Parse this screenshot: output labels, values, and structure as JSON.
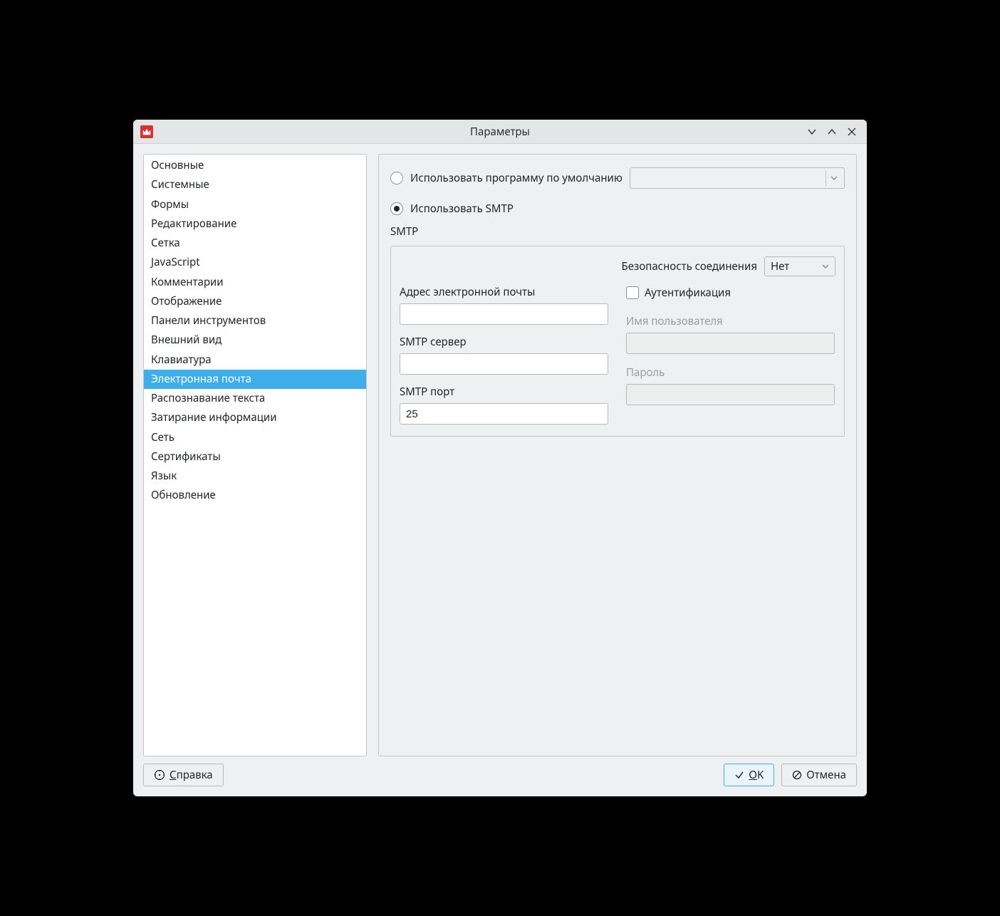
{
  "window": {
    "title": "Параметры"
  },
  "sidebar": {
    "items": [
      "Основные",
      "Системные",
      "Формы",
      "Редактирование",
      "Сетка",
      "JavaScript",
      "Комментарии",
      "Отображение",
      "Панели инструментов",
      "Внешний вид",
      "Клавиатура",
      "Электронная почта",
      "Распознавание текста",
      "Затирание информации",
      "Сеть",
      "Сертификаты",
      "Язык",
      "Обновление"
    ],
    "selected_index": 11
  },
  "email": {
    "use_default_program_label": "Использовать программу по умолчанию",
    "use_smtp_label": "Использовать SMTP",
    "selected_option": "smtp",
    "smtp_group_label": "SMTP",
    "connection_security_label": "Безопасность соединения",
    "connection_security_value": "Нет",
    "email_address_label": "Адрес электронной почты",
    "email_address_value": "",
    "smtp_server_label": "SMTP сервер",
    "smtp_server_value": "",
    "smtp_port_label": "SMTP порт",
    "smtp_port_value": "25",
    "auth_checkbox_label": "Аутентификация",
    "auth_checked": false,
    "username_label": "Имя пользователя",
    "username_value": "",
    "password_label": "Пароль",
    "password_value": ""
  },
  "footer": {
    "help_first": "С",
    "help_rest": "правка",
    "ok_first": "O",
    "ok_rest": "K",
    "cancel": "Отмена"
  }
}
